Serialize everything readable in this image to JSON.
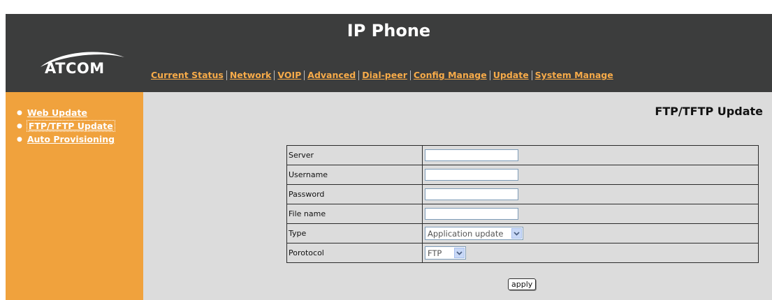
{
  "header": {
    "title": "IP Phone",
    "logo_text": "ATCOM"
  },
  "nav": {
    "items": [
      {
        "label": "Current Status"
      },
      {
        "label": "Network"
      },
      {
        "label": "VOIP"
      },
      {
        "label": "Advanced"
      },
      {
        "label": "Dial-peer"
      },
      {
        "label": "Config Manage"
      },
      {
        "label": "Update"
      },
      {
        "label": "System Manage"
      }
    ]
  },
  "sidebar": {
    "items": [
      {
        "label": "Web Update",
        "active": false
      },
      {
        "label": "FTP/TFTP Update",
        "active": true
      },
      {
        "label": "Auto Provisioning",
        "active": false
      }
    ]
  },
  "main": {
    "title": "FTP/TFTP Update",
    "form": {
      "server_label": "Server",
      "server_value": "",
      "username_label": "Username",
      "username_value": "",
      "password_label": "Password",
      "password_value": "",
      "filename_label": "File name",
      "filename_value": "",
      "type_label": "Type",
      "type_value": "Application update",
      "protocol_label": "Porotocol",
      "protocol_value": "FTP"
    },
    "apply_label": "apply"
  },
  "colors": {
    "header_bg": "#3c3d3d",
    "accent_orange": "#f0a23d",
    "content_bg": "#dcdcdc"
  }
}
